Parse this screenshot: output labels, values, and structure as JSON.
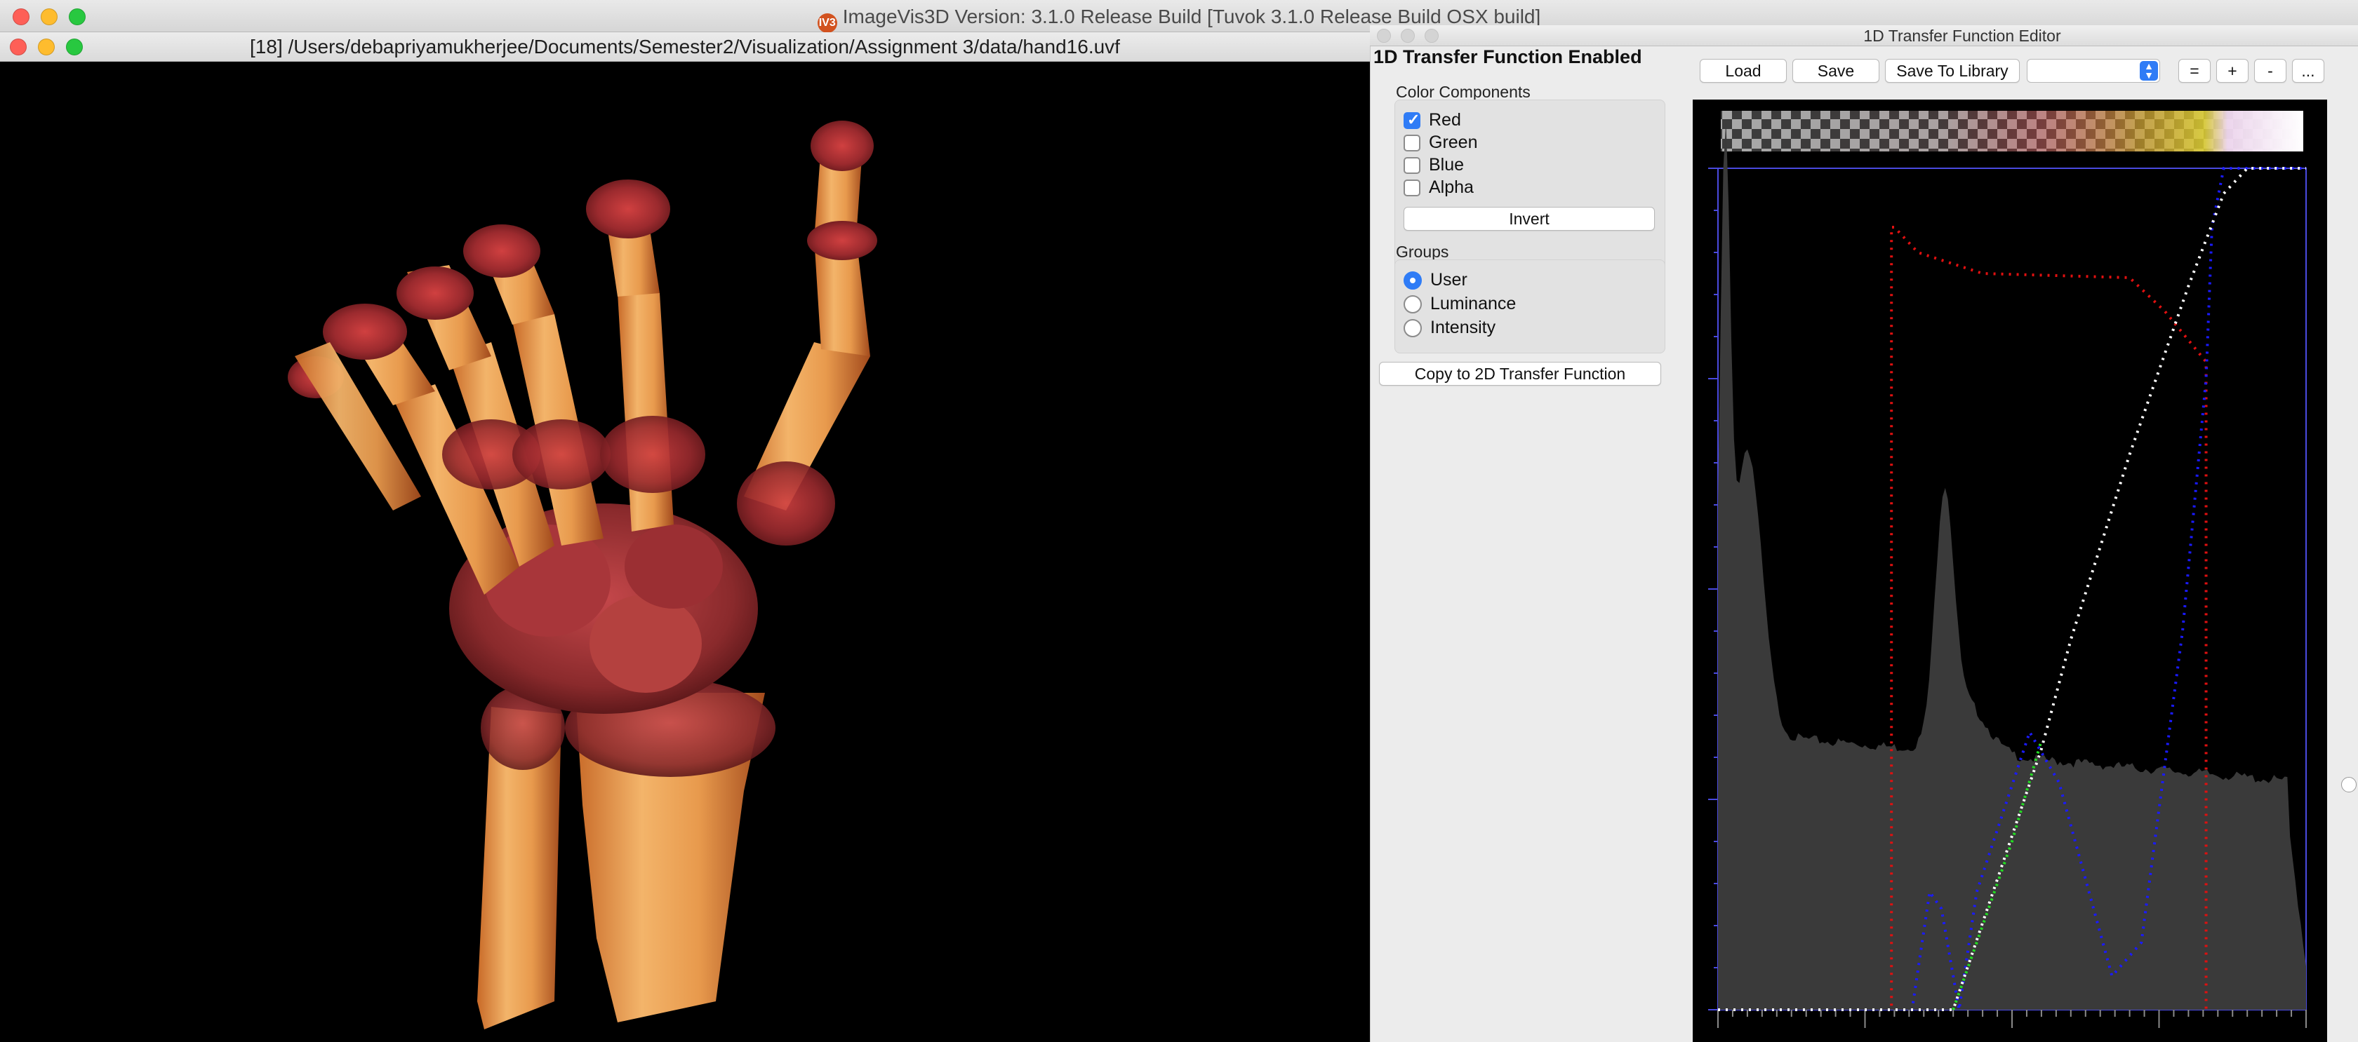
{
  "app": {
    "title": "ImageVis3D Version: 3.1.0 Release Build [Tuvok 3.1.0 Release Build OSX build]",
    "logo_text": "IV3"
  },
  "render_window": {
    "title": "[18] /Users/debapriyamukherjee/Documents/Semester2/Visualization/Assignment 3/data/hand16.uvf"
  },
  "tf_panel": {
    "enabled_label": "1D Transfer Function Enabled",
    "color_components_title": "Color Components",
    "components": [
      {
        "label": "Red",
        "checked": true
      },
      {
        "label": "Green",
        "checked": false
      },
      {
        "label": "Blue",
        "checked": false
      },
      {
        "label": "Alpha",
        "checked": false
      }
    ],
    "invert_label": "Invert",
    "groups_title": "Groups",
    "groups": [
      {
        "label": "User",
        "selected": true
      },
      {
        "label": "Luminance",
        "selected": false
      },
      {
        "label": "Intensity",
        "selected": false
      }
    ],
    "copy_label": "Copy to 2D Transfer Function"
  },
  "editor": {
    "title": "1D Transfer Function Editor",
    "toolbar": {
      "load_label": "Load",
      "save_label": "Save",
      "save_library_label": "Save To Library",
      "preset_value": "",
      "equal_label": "=",
      "plus_label": "+",
      "minus_label": "-",
      "more_label": "..."
    }
  },
  "colors": {
    "accent": "#2f7cf6",
    "histogram": "#3a3a3a",
    "red_curve": "#e01010",
    "green_curve": "#22dd22",
    "blue_curve": "#1a1aff",
    "alpha_curve": "#ffffff",
    "frame": "#4a4adf"
  }
}
